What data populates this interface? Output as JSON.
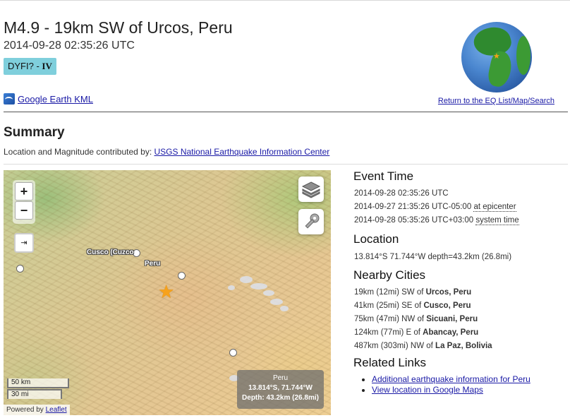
{
  "event": {
    "title": "M4.9 - 19km SW of Urcos, Peru",
    "datetime": "2014-09-28 02:35:26 UTC",
    "dyfi_label": "DYFI? -",
    "dyfi_value": "IV"
  },
  "links": {
    "kml": "Google Earth KML",
    "return": "Return to the EQ List/Map/Search"
  },
  "summary": {
    "heading": "Summary",
    "contrib_prefix": "Location and Magnitude contributed by:",
    "contrib_link": "USGS National Earthquake Information Center"
  },
  "map": {
    "zoom_in": "+",
    "zoom_out": "−",
    "labels": {
      "cusco": "Cusco (Cuzco",
      "peru": "Peru"
    },
    "info": {
      "line1": "Peru",
      "line2": "13.814°S, 71.744°W",
      "line3": "Depth: 43.2km (26.8mi)"
    },
    "scale": {
      "km": "50 km",
      "mi": "30 mi"
    },
    "attribution_prefix": "Powered by",
    "attribution_link": "Leaflet",
    "accent_star": "#f7a21b"
  },
  "event_time": {
    "heading": "Event Time",
    "utc": "2014-09-28 02:35:26 UTC",
    "epicenter_time": "2014-09-27 21:35:26 UTC-05:00",
    "epicenter_label": "at epicenter",
    "system_time": "2014-09-28 05:35:26 UTC+03:00",
    "system_label": "system time"
  },
  "location": {
    "heading": "Location",
    "text": "13.814°S 71.744°W depth=43.2km (26.8mi)"
  },
  "nearby": {
    "heading": "Nearby Cities",
    "items": [
      {
        "prefix": "19km (12mi) SW of",
        "city": "Urcos, Peru"
      },
      {
        "prefix": "41km (25mi) SE of",
        "city": "Cusco, Peru"
      },
      {
        "prefix": "75km (47mi) NW of",
        "city": "Sicuani, Peru"
      },
      {
        "prefix": "124km (77mi) E of",
        "city": "Abancay, Peru"
      },
      {
        "prefix": "487km (303mi) NW of",
        "city": "La Paz, Bolivia"
      }
    ]
  },
  "related": {
    "heading": "Related Links",
    "items": [
      "Additional earthquake information for Peru",
      "View location in Google Maps"
    ]
  }
}
